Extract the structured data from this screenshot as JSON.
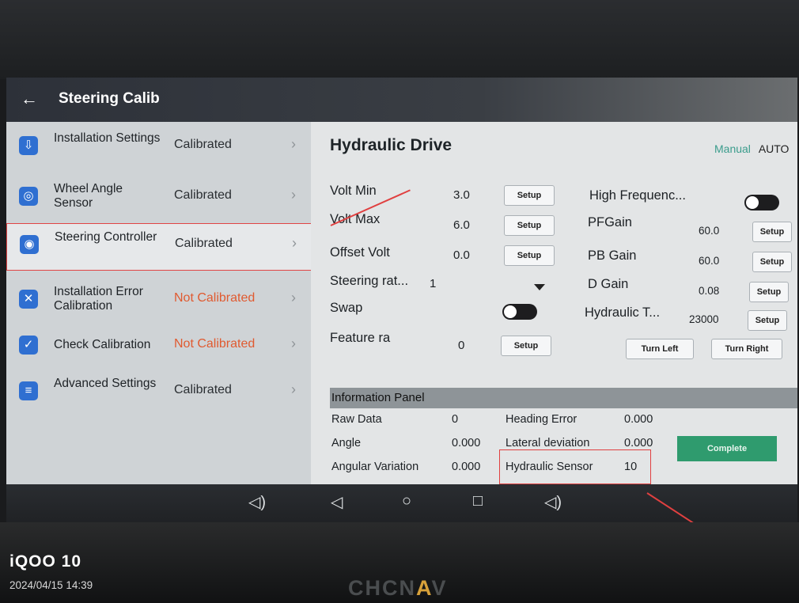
{
  "header": {
    "back_icon": "←",
    "title": "Steering Calib"
  },
  "sidebar": {
    "items": [
      {
        "icon": "⇩",
        "label": "Installation Settings",
        "status": "Calibrated",
        "status_bad": false
      },
      {
        "icon": "◎",
        "label": "Wheel Angle Sensor",
        "status": "Calibrated",
        "status_bad": false
      },
      {
        "icon": "◉",
        "label": "Steering Controller",
        "status": "Calibrated",
        "status_bad": false
      },
      {
        "icon": "✕",
        "label": "Installation Error Calibration",
        "status": "Not Calibrated",
        "status_bad": true
      },
      {
        "icon": "✓",
        "label": "Check Calibration",
        "status": "Not Calibrated",
        "status_bad": true
      },
      {
        "icon": "≡",
        "label": "Advanced Settings",
        "status": "Calibrated",
        "status_bad": false
      }
    ],
    "chevron": "›"
  },
  "main": {
    "title": "Hydraulic Drive",
    "mode_manual": "Manual",
    "mode_auto": "AUTO",
    "left_rows": [
      {
        "label": "Volt Min",
        "value": "3.0",
        "button": "Setup"
      },
      {
        "label": "Volt Max",
        "value": "6.0",
        "button": "Setup"
      },
      {
        "label": "Offset Volt",
        "value": "0.0",
        "button": "Setup"
      },
      {
        "label": "Steering rat...",
        "value": "1"
      },
      {
        "label": "Swap"
      },
      {
        "label": "Feature ra",
        "value": "0",
        "button": "Setup"
      }
    ],
    "right_rows": [
      {
        "label": "High Frequenc..."
      },
      {
        "label": "PFGain",
        "value": "60.0",
        "button": "Setup"
      },
      {
        "label": "PB Gain",
        "value": "60.0",
        "button": "Setup"
      },
      {
        "label": "D Gain",
        "value": "0.08",
        "button": "Setup"
      },
      {
        "label": "Hydraulic T...",
        "value": "23000",
        "button": "Setup"
      }
    ],
    "turn_left": "Turn Left",
    "turn_right": "Turn Right",
    "info_title": "Information Panel",
    "info": {
      "raw_data_label": "Raw Data",
      "raw_data": "0",
      "angle_label": "Angle",
      "angle": "0.000",
      "angular_label": "Angular Variation",
      "angular": "0.000",
      "heading_label": "Heading Error",
      "heading": "0.000",
      "lateral_label": "Lateral deviation",
      "lateral": "0.000",
      "hydraulic_label": "Hydraulic Sensor",
      "hydraulic": "10"
    },
    "complete": "Complete"
  },
  "navbar": {
    "back": "◁",
    "home": "○",
    "recents": "□",
    "volume": "◁)"
  },
  "photo": {
    "brand": "iQOO 10",
    "timestamp": "2024/04/15 14:39",
    "device_brand_a": "CHCN",
    "device_brand_b": "A",
    "device_brand_c": "V"
  }
}
